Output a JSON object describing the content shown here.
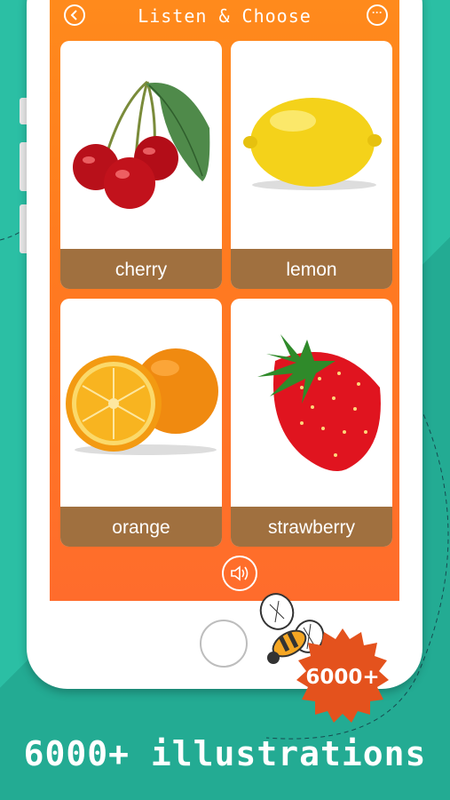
{
  "header": {
    "title": "Listen & Choose"
  },
  "cards": [
    {
      "label": "cherry",
      "icon": "cherry-image"
    },
    {
      "label": "lemon",
      "icon": "lemon-image"
    },
    {
      "label": "orange",
      "icon": "orange-image"
    },
    {
      "label": "strawberry",
      "icon": "strawberry-image"
    }
  ],
  "badge": {
    "text": "6000+"
  },
  "caption": {
    "text": "6000+ illustrations"
  },
  "colors": {
    "background": "#2bbfa4",
    "screen_orange": "#ff7a20",
    "label_brown": "#a0703f",
    "badge_red": "#e4521d"
  }
}
